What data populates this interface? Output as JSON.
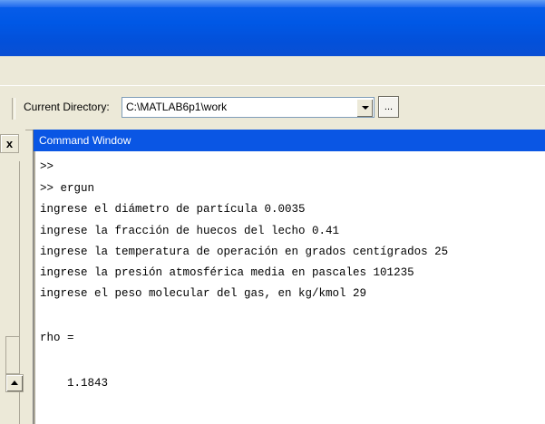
{
  "toolbar": {
    "current_directory_label": "Current Directory:",
    "current_directory_value": "C:\\MATLAB6p1\\work",
    "browse_label": "..."
  },
  "left_panel": {
    "close_label": "x"
  },
  "command_window": {
    "title": "Command Window",
    "lines": [
      ">>",
      ">> ergun",
      "ingrese el diámetro de partícula 0.0035",
      "ingrese la fracción de huecos del lecho 0.41",
      "ingrese la temperatura de operación en grados centígrados 25",
      "ingrese la presión atmosférica media en pascales 101235",
      "ingrese el peso molecular del gas, en kg/kmol 29",
      "rho =",
      "    1.1843"
    ]
  },
  "colors": {
    "title_bar": "#0058e6",
    "command_title_bar": "#0a56e4",
    "chrome": "#ece9d8"
  }
}
